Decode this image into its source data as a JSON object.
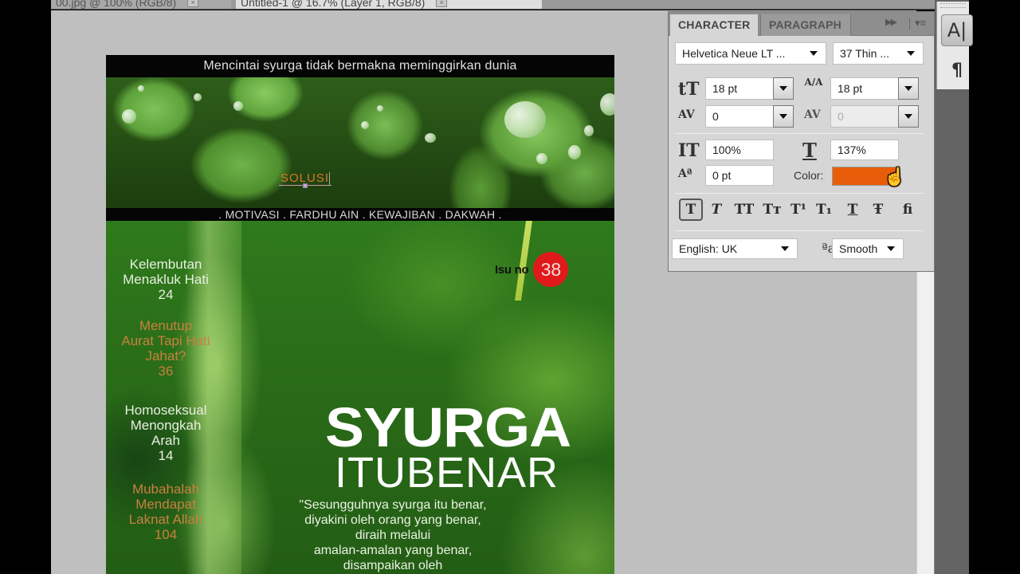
{
  "tabs": [
    {
      "label": "00.jpg @ 100% (RGB/8)",
      "active": false
    },
    {
      "label": "Untitled-1 @ 16.7% (Layer 1, RGB/8)",
      "active": true
    }
  ],
  "mini_dock": {
    "character_icon": "A|",
    "paragraph_icon": "¶"
  },
  "panel": {
    "tabs": [
      "CHARACTER",
      "PARAGRAPH"
    ],
    "collapse_icon": "▶▶",
    "menu_icon": "▾≡",
    "font_family": "Helvetica Neue LT ...",
    "font_style": "37 Thin ...",
    "font_size": "18 pt",
    "leading": "18 pt",
    "kerning": "0",
    "tracking": "0",
    "vertical_scale": "100%",
    "horizontal_scale": "137%",
    "baseline_shift": "0 pt",
    "color_label": "Color:",
    "color_value": "#e85d0a",
    "style_buttons": [
      {
        "glyph": "T",
        "name": "faux-bold",
        "active": true
      },
      {
        "glyph": "T",
        "name": "faux-italic",
        "active": false
      },
      {
        "glyph": "TT",
        "name": "all-caps",
        "active": false
      },
      {
        "glyph": "Tт",
        "name": "small-caps",
        "active": false
      },
      {
        "glyph": "T¹",
        "name": "superscript",
        "active": false
      },
      {
        "glyph": "T₁",
        "name": "subscript",
        "active": false
      },
      {
        "glyph": "T",
        "name": "underline",
        "active": false
      },
      {
        "glyph": "Ŧ",
        "name": "strikethrough",
        "active": false
      },
      {
        "glyph": "ﬁ",
        "name": "ligatures",
        "active": false
      }
    ],
    "language": "English: UK",
    "antialias_icon": "ªa",
    "antialias": "Smooth",
    "icons": {
      "font_size": "tT",
      "leading": "A/A",
      "kerning": "AV",
      "tracking": "AV",
      "vertical_scale": "IT",
      "horizontal_scale": "T",
      "baseline": "Aª"
    }
  },
  "document": {
    "tagline": "Mencintai syurga tidak bermakna meminggirkan dunia",
    "editing_text": "SOLUSI",
    "nav": ". MOTIVASI . FARDHU AIN . KEWAJIBAN . DAKWAH .",
    "issue_label": "Isu no",
    "issue_number": "38",
    "toc": [
      {
        "lines": [
          "Kelembutan",
          "Menakluk Hati"
        ],
        "page": "24",
        "color": "white"
      },
      {
        "lines": [
          "Menutup",
          "Aurat Tapi Hati",
          "Jahat?"
        ],
        "page": "36",
        "color": "orange"
      },
      {
        "lines": [
          "Homoseksual",
          "Menongkah",
          "Arah"
        ],
        "page": "14",
        "color": "white"
      },
      {
        "lines": [
          "Mubahalah",
          "Mendapat",
          "Laknat Allah"
        ],
        "page": "104",
        "color": "orange"
      }
    ],
    "title_main": "SYURGA",
    "title_sub": "ITUBENAR",
    "quote_lines": [
      "\"Sesungguhnya syurga itu benar,",
      "diyakini oleh orang yang benar,",
      "diraih melalui",
      "amalan-amalan yang benar,",
      "disampaikan oleh"
    ]
  }
}
